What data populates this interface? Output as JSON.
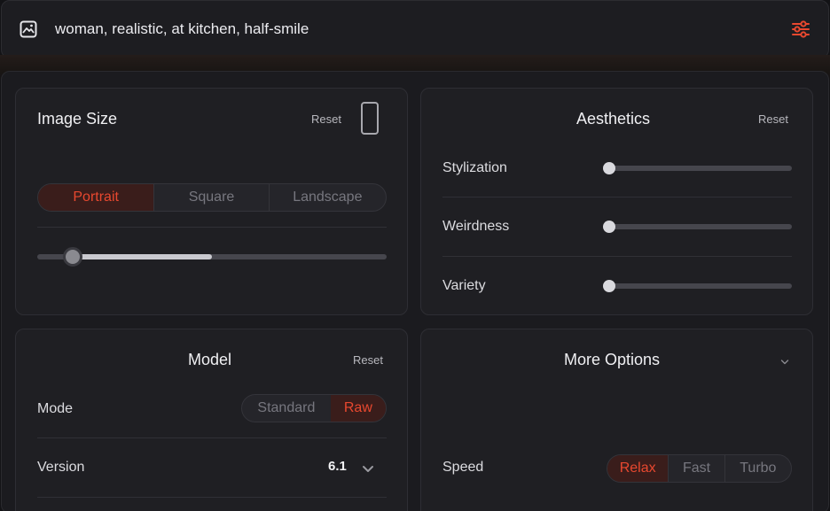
{
  "prompt": {
    "text": "woman, realistic, at kitchen, half-smile",
    "image_icon": "image-icon",
    "settings_icon": "sliders-icon",
    "accent_color": "#e8482f"
  },
  "image_size": {
    "title": "Image Size",
    "reset_label": "Reset",
    "orientation_icon": "portrait-frame-icon",
    "options": [
      "Portrait",
      "Square",
      "Landscape"
    ],
    "selected": "Portrait",
    "slider_fraction": 0.1
  },
  "aesthetics": {
    "title": "Aesthetics",
    "reset_label": "Reset",
    "sliders": [
      {
        "label": "Stylization",
        "value_fraction": 0
      },
      {
        "label": "Weirdness",
        "value_fraction": 0
      },
      {
        "label": "Variety",
        "value_fraction": 0
      }
    ]
  },
  "model": {
    "title": "Model",
    "reset_label": "Reset",
    "mode_label": "Mode",
    "mode_options": [
      "Standard",
      "Raw"
    ],
    "mode_selected": "Raw",
    "version_label": "Version",
    "version_value": "6.1",
    "version_icon": "chevron-down-icon"
  },
  "more_options": {
    "title": "More Options",
    "collapse_icon": "chevron-down-icon",
    "speed_label": "Speed",
    "speed_options": [
      "Relax",
      "Fast",
      "Turbo"
    ],
    "speed_selected": "Relax"
  }
}
